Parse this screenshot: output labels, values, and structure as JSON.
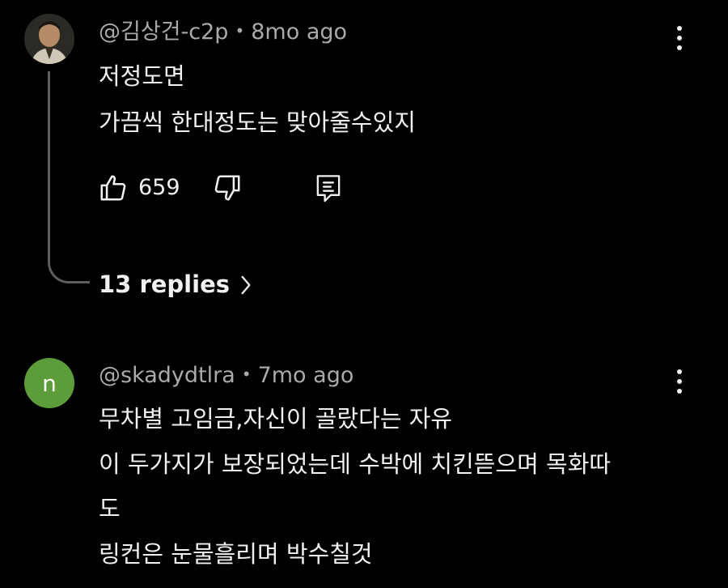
{
  "comments": [
    {
      "author": "@김상건-c2p",
      "separator": "•",
      "time": "8mo ago",
      "lines": [
        "저정도면",
        "가끔씩 한대정도는 맞아줄수있지"
      ],
      "likes": "659",
      "replies_label": "13 replies",
      "icons": {
        "more": "more-vert-icon",
        "like": "thumbs-up-icon",
        "dislike": "thumbs-down-icon",
        "reply": "reply-comment-icon",
        "chevron": "chevron-right-icon"
      }
    },
    {
      "author": "@skadydtlra",
      "separator": "•",
      "time": "7mo ago",
      "avatar_letter": "n",
      "avatar_color": "#5c9c3a",
      "lines": [
        "무차별 고임금,자신이 골랐다는 자유",
        "이 두가지가 보장되었는데 수박에 치킨뜯으며 목화따",
        "도",
        "링컨은 눈물흘리며 박수칠것"
      ],
      "icons": {
        "more": "more-vert-icon"
      }
    }
  ],
  "theme": {
    "background": "#000000",
    "text": "#f1f1f1",
    "meta_text": "#aaaaaa",
    "thread_line": "#5e5e5e"
  }
}
